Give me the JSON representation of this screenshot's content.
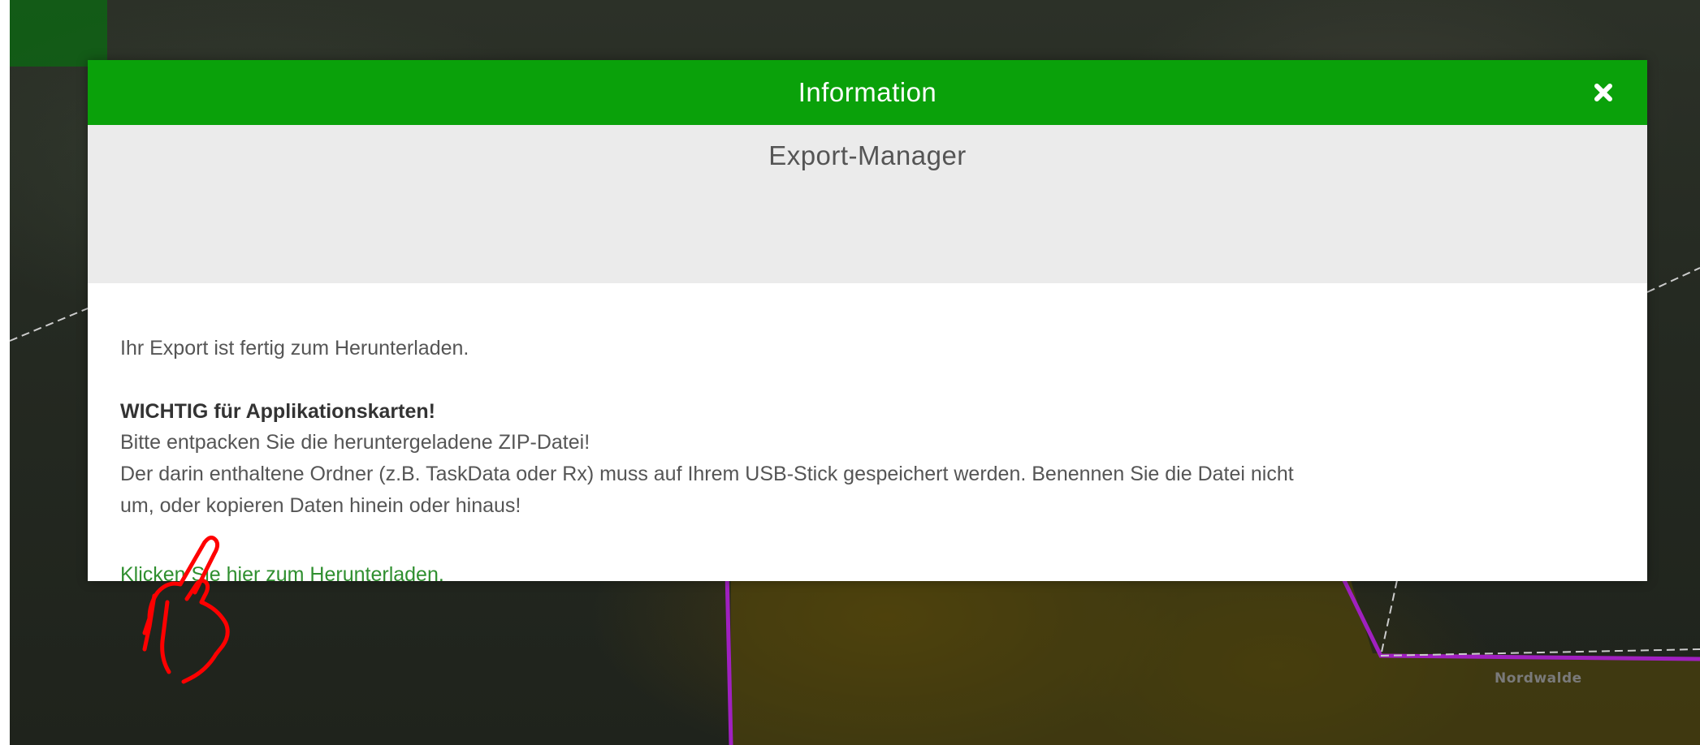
{
  "modal": {
    "title": "Information",
    "subtitle": "Export-Manager",
    "body": {
      "ready_text": "Ihr Export ist fertig zum Herunterladen.",
      "important_heading": "WICHTIG für Applikationskarten!",
      "unpack_text": "Bitte entpacken Sie die heruntergeladene ZIP-Datei!",
      "folder_text_line1": "Der darin enthaltene Ordner (z.B. TaskData oder Rx) muss auf Ihrem USB-Stick gespeichert werden. Benennen Sie die Datei nicht",
      "folder_text_line2": "um, oder kopieren Daten hinein oder hinaus!",
      "download_link": "Klicken Sie hier zum Herunterladen."
    },
    "close_icon": "close-icon",
    "colors": {
      "header_bg": "#0aa10a",
      "subheader_bg": "#ebebeb",
      "link": "#2f8f2f"
    }
  },
  "map": {
    "place_label": "Nordwalde"
  },
  "annotation": {
    "icon": "hand-pointer-icon",
    "color": "#ff0000"
  }
}
